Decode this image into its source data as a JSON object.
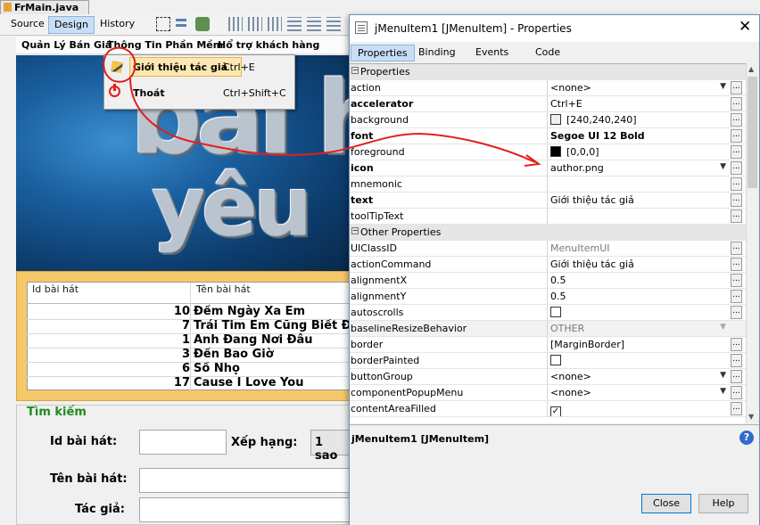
{
  "editor": {
    "file_tab": "FrMain.java",
    "view_tabs": [
      "Source",
      "Design",
      "History"
    ]
  },
  "form": {
    "menubar": [
      "Quản Lý Bán Giá",
      "Thông Tin Phần Mềm",
      "Hổ trợ khách hàng"
    ],
    "dropdown": [
      {
        "label": "Giới thiệu tác giả",
        "shortcut": "Ctrl+E"
      },
      {
        "label": "Thoát",
        "shortcut": "Ctrl+Shift+C"
      }
    ],
    "banner_line1": "bai h",
    "banner_line2": "yêu",
    "table": {
      "columns": [
        "Id bài hát",
        "Tên bài hát"
      ],
      "rows": [
        {
          "id": "10",
          "name": "Đếm Ngày Xa Em"
        },
        {
          "id": "7",
          "name": "Trái Tim Em Cũng Biết Đ..."
        },
        {
          "id": "1",
          "name": "Anh Đang Nơi Đâu"
        },
        {
          "id": "3",
          "name": "Đến Bao Giờ"
        },
        {
          "id": "6",
          "name": "Số Nhọ"
        },
        {
          "id": "17",
          "name": "Cause I Love You"
        }
      ]
    },
    "search": {
      "title": "Tìm kiếm",
      "id_label": "Id bài hát:",
      "rank_label": "Xếp hạng:",
      "rank_value": "1 sao",
      "name_label": "Tên bài hát:",
      "author_label": "Tác giả:"
    }
  },
  "dialog": {
    "title": "jMenuItem1 [JMenuItem] - Properties",
    "tabs": [
      "Properties",
      "Binding",
      "Events",
      "Code"
    ],
    "groups": {
      "properties": "Properties",
      "other": "Other Properties"
    },
    "props": {
      "action": {
        "name": "action",
        "value": "<none>"
      },
      "accelerator": {
        "name": "accelerator",
        "value": "Ctrl+E"
      },
      "background": {
        "name": "background",
        "value": "[240,240,240]"
      },
      "font": {
        "name": "font",
        "value": "Segoe UI 12 Bold"
      },
      "foreground": {
        "name": "foreground",
        "value": "[0,0,0]"
      },
      "icon": {
        "name": "icon",
        "value": "author.png"
      },
      "mnemonic": {
        "name": "mnemonic",
        "value": ""
      },
      "text": {
        "name": "text",
        "value": "Giới thiệu tác giả"
      },
      "tooltip": {
        "name": "toolTipText",
        "value": ""
      },
      "uiclass": {
        "name": "UIClassID",
        "value": "MenuItemUI"
      },
      "actioncommand": {
        "name": "actionCommand",
        "value": "Giới thiệu tác giả"
      },
      "alignx": {
        "name": "alignmentX",
        "value": "0.5"
      },
      "aligny": {
        "name": "alignmentY",
        "value": "0.5"
      },
      "autoscrolls": {
        "name": "autoscrolls",
        "value": ""
      },
      "baseline": {
        "name": "baselineResizeBehavior",
        "value": "OTHER"
      },
      "border": {
        "name": "border",
        "value": "[MarginBorder]"
      },
      "borderpainted": {
        "name": "borderPainted",
        "value": ""
      },
      "buttongroup": {
        "name": "buttonGroup",
        "value": "<none>"
      },
      "popupmenu": {
        "name": "componentPopupMenu",
        "value": "<none>"
      },
      "contentarea": {
        "name": "contentAreaFilled",
        "value": ""
      }
    },
    "description_title": "jMenuItem1 [JMenuItem]",
    "close_label": "Close",
    "help_label": "Help"
  },
  "annotation_color": "#e0201f"
}
